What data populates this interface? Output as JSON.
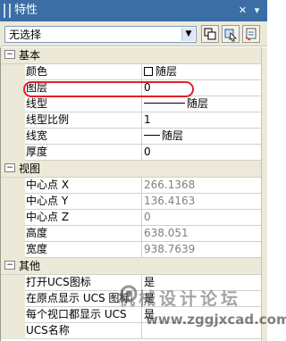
{
  "title": "特性",
  "selection": {
    "value": "无选择"
  },
  "groups": [
    {
      "title": "基本",
      "props": [
        {
          "name": "颜色",
          "value": "随层",
          "kind": "color"
        },
        {
          "name": "图层",
          "value": "0"
        },
        {
          "name": "线型",
          "value": "随层",
          "kind": "line"
        },
        {
          "name": "线型比例",
          "value": "1"
        },
        {
          "name": "线宽",
          "value": "随层",
          "kind": "line-short"
        },
        {
          "name": "厚度",
          "value": "0"
        }
      ]
    },
    {
      "title": "视图",
      "props": [
        {
          "name": "中心点 X",
          "value": "266.1368",
          "readonly": true
        },
        {
          "name": "中心点 Y",
          "value": "136.4163",
          "readonly": true
        },
        {
          "name": "中心点 Z",
          "value": "0",
          "readonly": true
        },
        {
          "name": "高度",
          "value": "638.051",
          "readonly": true
        },
        {
          "name": "宽度",
          "value": "938.7639",
          "readonly": true
        }
      ]
    },
    {
      "title": "其他",
      "props": [
        {
          "name": "打开UCS图标",
          "value": "是"
        },
        {
          "name": "在原点显示 UCS 图标",
          "value": "是"
        },
        {
          "name": "每个视口都显示 UCS",
          "value": "是"
        },
        {
          "name": "UCS名称",
          "value": ""
        }
      ]
    }
  ],
  "watermark": {
    "text_cn": "机械设计论坛",
    "text_url": "www.zggjxcad.com"
  },
  "colors": {
    "titlebar": "#3a6ea5",
    "panel": "#ece9d8",
    "highlight": "#e0202a"
  }
}
